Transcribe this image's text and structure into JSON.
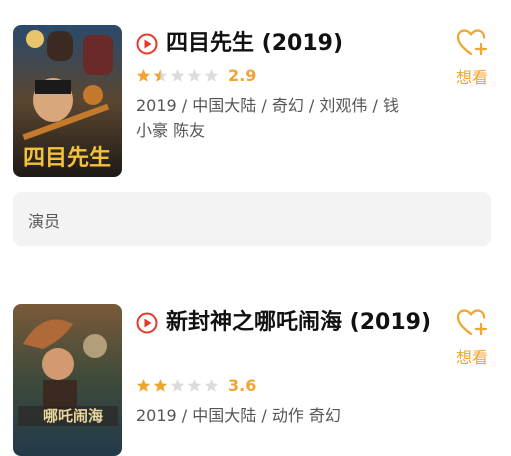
{
  "movies": [
    {
      "title": "四目先生 (2019)",
      "rating": 2.9,
      "rating_text": "2.9",
      "meta": "2019 / 中国大陆 / 奇幻 / 刘观伟 / 钱小豪 陈友",
      "want_label": "想看",
      "poster_text": "四目先生",
      "icon": "play-circle-icon"
    },
    {
      "title": "新封神之哪吒闹海 (2019)",
      "rating": 3.6,
      "rating_text": "3.6",
      "meta": "2019 / 中国大陆 / 动作 奇幻",
      "want_label": "想看",
      "poster_text": "哪吒闹海",
      "icon": "play-circle-icon"
    }
  ],
  "actors_section": {
    "label": "演员"
  },
  "colors": {
    "accent": "#f0a531",
    "play_red": "#e6372a",
    "box_bg": "#f3f3f3"
  },
  "icons": {
    "want": "heart-plus-icon",
    "star_full": "star-filled-icon",
    "star_empty": "star-empty-icon"
  }
}
